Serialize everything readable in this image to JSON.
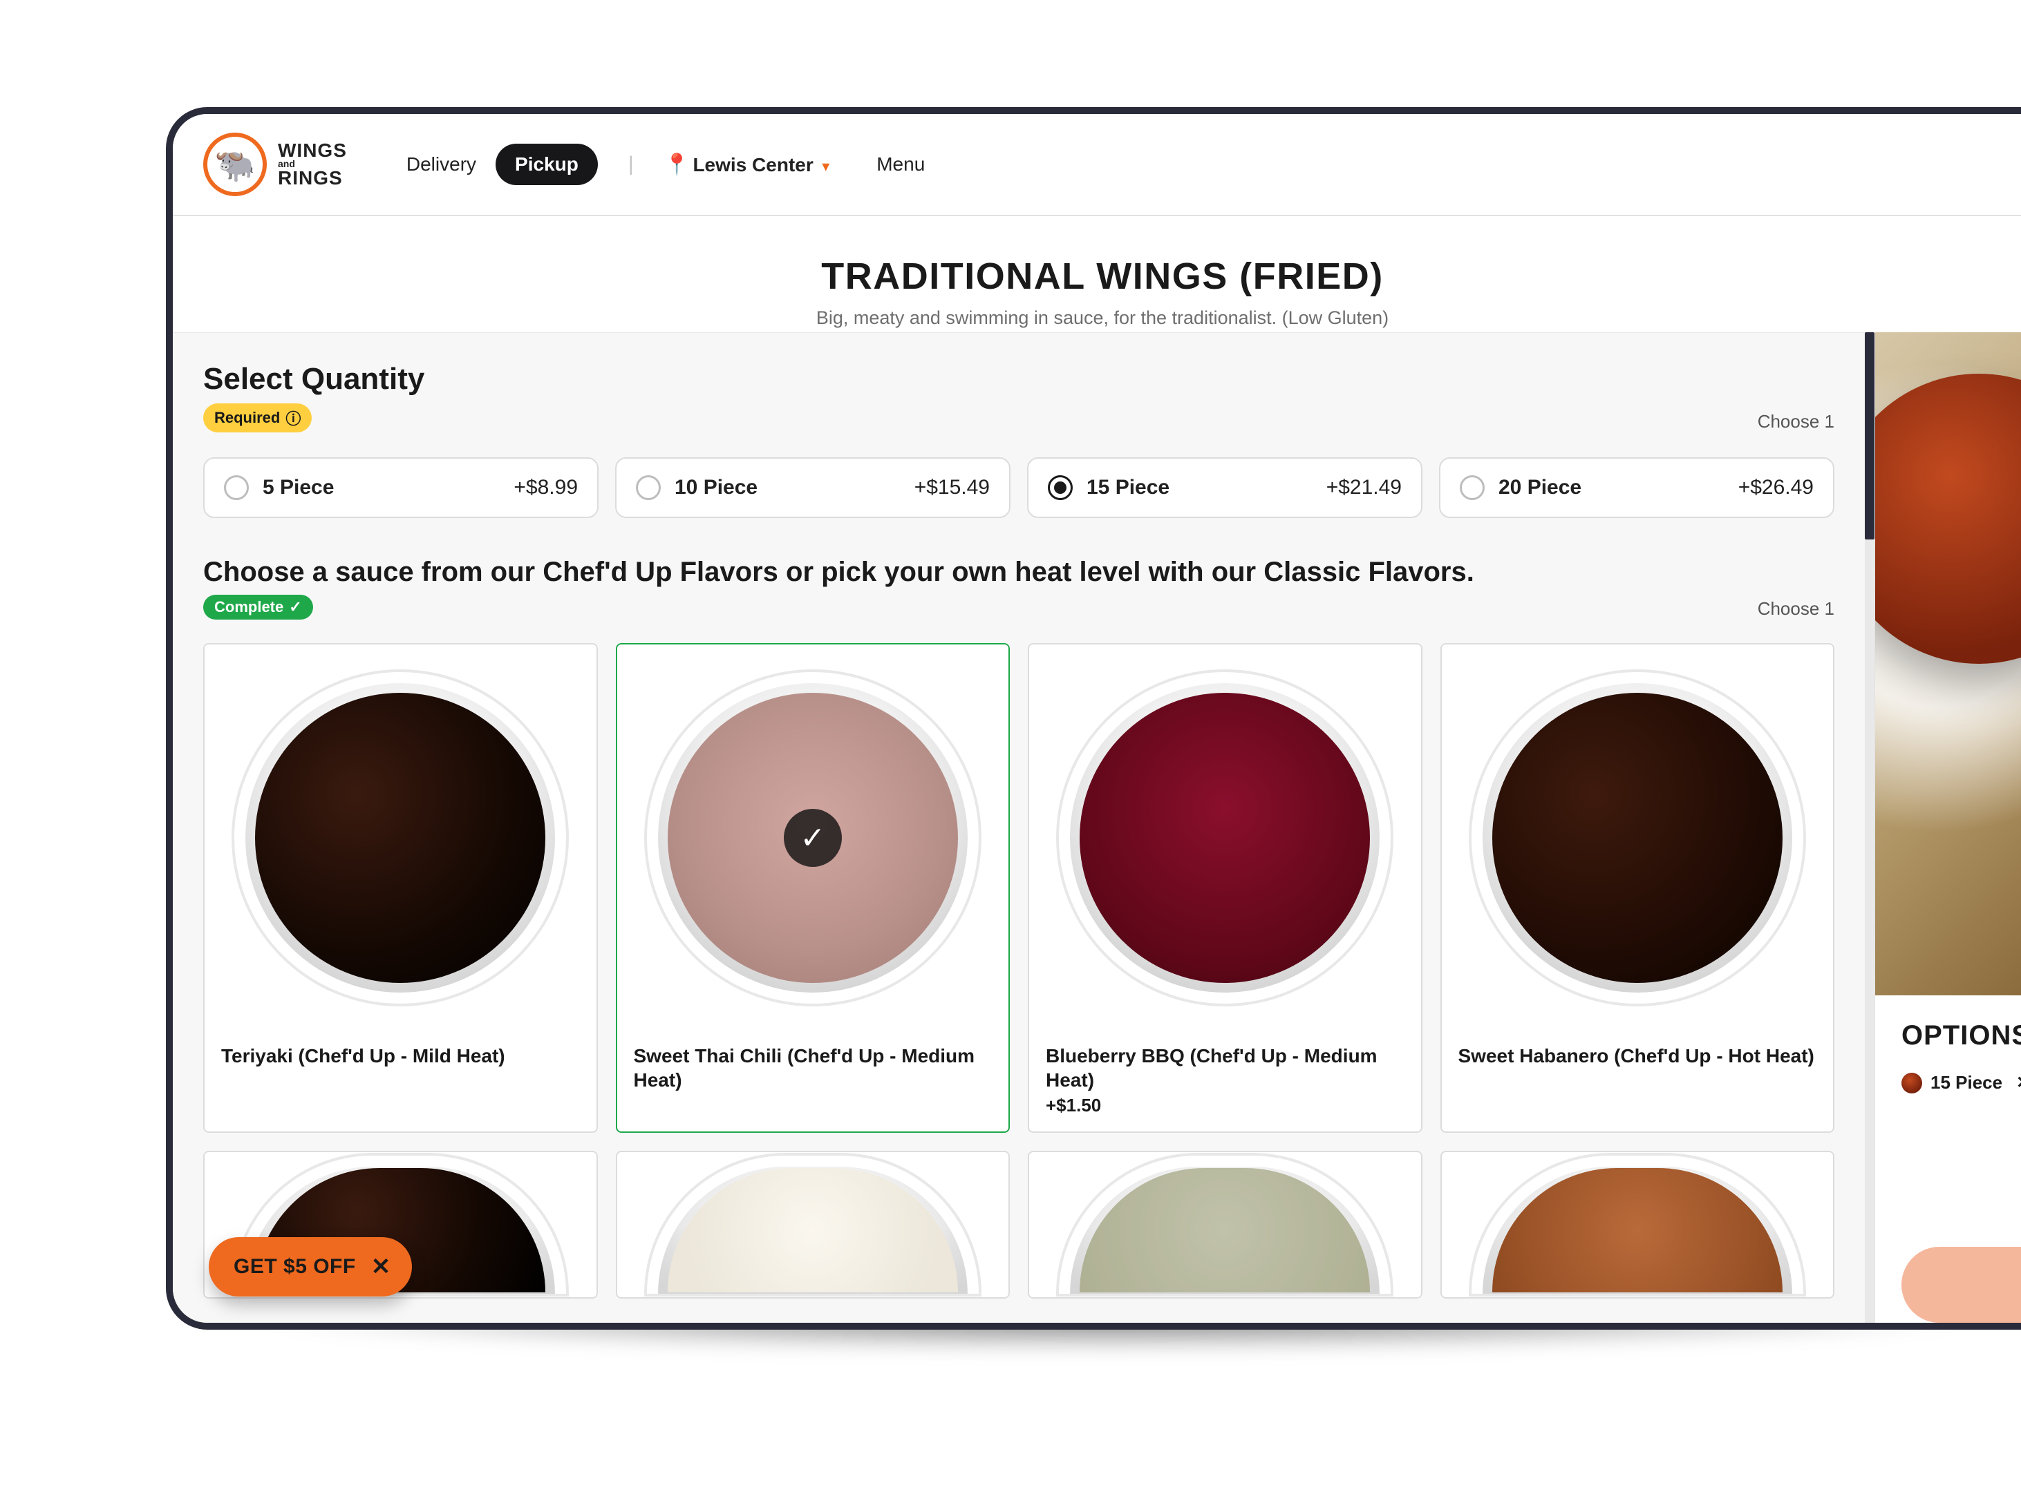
{
  "brand": {
    "line1": "WINGS",
    "and": "and",
    "line2": "RINGS"
  },
  "nav": {
    "delivery": "Delivery",
    "pickup": "Pickup",
    "location": "Lewis Center",
    "menu": "Menu"
  },
  "product": {
    "title": "TRADITIONAL WINGS (FRIED)",
    "subtitle": "Big, meaty and swimming in sauce, for the traditionalist. (Low Gluten)"
  },
  "quantity": {
    "heading": "Select Quantity",
    "badge": "Required",
    "choose": "Choose 1",
    "options": [
      {
        "label": "5 Piece",
        "price": "+$8.99",
        "selected": false
      },
      {
        "label": "10 Piece",
        "price": "+$15.49",
        "selected": false
      },
      {
        "label": "15 Piece",
        "price": "+$21.49",
        "selected": true
      },
      {
        "label": "20 Piece",
        "price": "+$26.49",
        "selected": false
      }
    ]
  },
  "sauce": {
    "heading": "Choose a sauce from our Chef'd Up Flavors or pick your own heat level with our Classic Flavors.",
    "badge": "Complete",
    "choose": "Choose 1",
    "items": [
      {
        "name": "Teriyaki (Chef'd Up - Mild Heat)",
        "price": "",
        "selected": false,
        "swatch": "teriyaki"
      },
      {
        "name": "Sweet Thai Chili (Chef'd Up - Medium Heat)",
        "price": "",
        "selected": true,
        "swatch": "thai"
      },
      {
        "name": "Blueberry BBQ (Chef'd Up - Medium Heat)",
        "price": "+$1.50",
        "selected": false,
        "swatch": "bbq"
      },
      {
        "name": "Sweet Habanero (Chef'd Up - Hot Heat)",
        "price": "",
        "selected": false,
        "swatch": "habanero"
      }
    ],
    "row2": [
      {
        "swatch": "teriyaki"
      },
      {
        "swatch": "cream"
      },
      {
        "swatch": "herb"
      },
      {
        "swatch": "spice"
      }
    ]
  },
  "sidebar": {
    "options_heading": "OPTIONS",
    "selected_chip": "15 Piece"
  },
  "promo": {
    "label": "GET $5 OFF"
  }
}
